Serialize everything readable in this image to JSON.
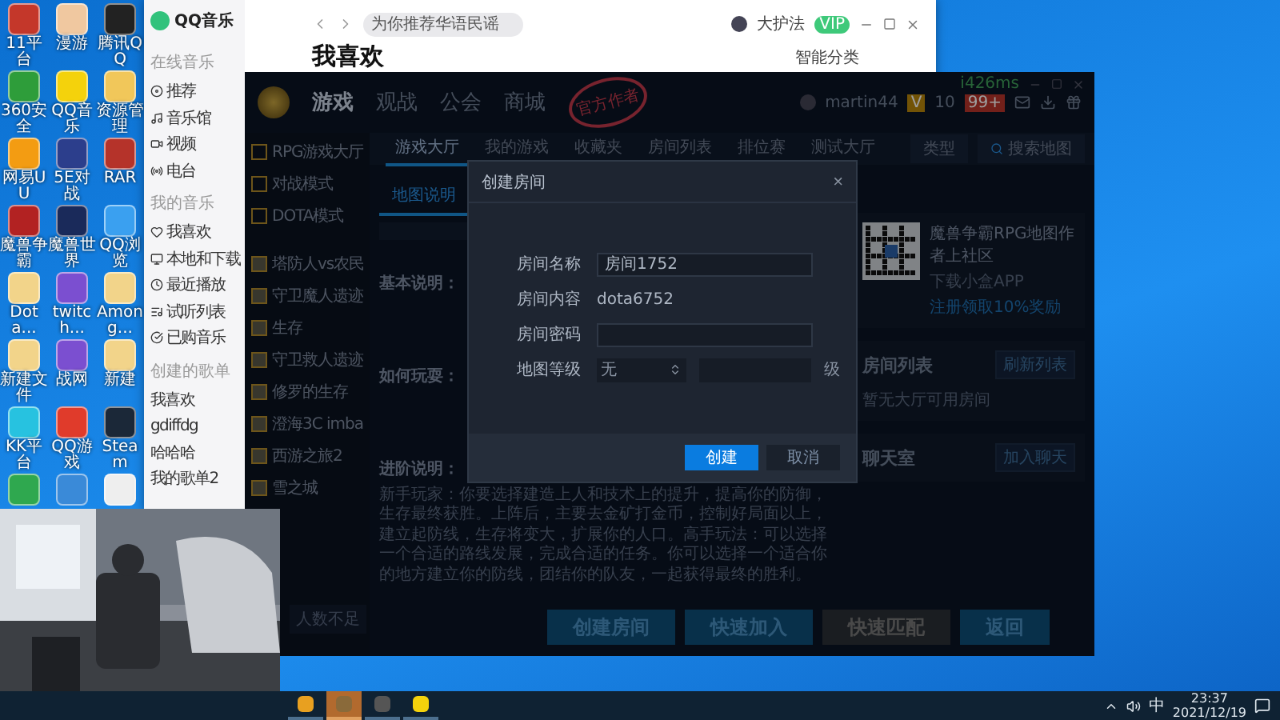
{
  "desktop": {
    "icons": [
      {
        "label": "11平台"
      },
      {
        "label": "漫游"
      },
      {
        "label": "腾讯QQ"
      },
      {
        "label": "360安全"
      },
      {
        "label": "QQ音乐"
      },
      {
        "label": "资源管理"
      },
      {
        "label": "网易UU"
      },
      {
        "label": "5E对战"
      },
      {
        "label": "RAR"
      },
      {
        "label": "魔兽争霸"
      },
      {
        "label": "魔兽世界"
      },
      {
        "label": "QQ浏览"
      },
      {
        "label": "Dota..."
      },
      {
        "label": "twitch..."
      },
      {
        "label": "Among..."
      },
      {
        "label": "新建文件"
      },
      {
        "label": "战网"
      },
      {
        "label": "新建"
      },
      {
        "label": "KK平台"
      },
      {
        "label": "QQ游戏"
      },
      {
        "label": "Steam"
      }
    ]
  },
  "music_window": {
    "logo": "QQ音乐",
    "search": {
      "placeholder": "为你推荐华语民谣"
    },
    "user": "大护法",
    "vip": "VIP",
    "title": "我喜欢",
    "sort_button": "智能分类",
    "sidebar": [
      {
        "heading": "在线音乐",
        "items": [
          {
            "label": "推荐"
          },
          {
            "label": "音乐馆"
          },
          {
            "label": "视频"
          },
          {
            "label": "电台"
          }
        ]
      },
      {
        "heading": "我的音乐",
        "items": [
          {
            "label": "我喜欢"
          },
          {
            "label": "本地和下载"
          },
          {
            "label": "最近播放"
          },
          {
            "label": "试听列表"
          },
          {
            "label": "已购音乐"
          }
        ]
      },
      {
        "heading": "创建的歌单",
        "items": [
          {
            "label": "我喜欢"
          },
          {
            "label": "gdiffdg"
          },
          {
            "label": "哈哈哈"
          },
          {
            "label": "我的歌单2"
          }
        ]
      }
    ]
  },
  "game_window": {
    "ping": "i426ms",
    "nav": [
      {
        "label": "游戏",
        "selected": true
      },
      {
        "label": "观战",
        "selected": false
      },
      {
        "label": "公会",
        "selected": false
      },
      {
        "label": "商城",
        "selected": false
      }
    ],
    "stamp": "官方作者",
    "user": "martin44",
    "level": "V",
    "count": "10",
    "badge": "99+",
    "sidebar": [
      {
        "label": "RPG游戏大厅",
        "kind": "category"
      },
      {
        "label": "对战模式",
        "kind": "category"
      },
      {
        "label": "DOTA模式",
        "kind": "category"
      },
      {
        "label": "塔防人vs农民",
        "kind": "map"
      },
      {
        "label": "守卫魔人遗迹",
        "kind": "map"
      },
      {
        "label": "生存",
        "kind": "map"
      },
      {
        "label": "守卫救人遗迹",
        "kind": "map"
      },
      {
        "label": "修罗的生存",
        "kind": "map"
      },
      {
        "label": "澄海3C imba",
        "kind": "map"
      },
      {
        "label": "西游之旅2",
        "kind": "map"
      },
      {
        "label": "雪之城",
        "kind": "map"
      }
    ],
    "sidebar_footer": "人数不足",
    "tabs": [
      {
        "label": "游戏大厅",
        "selected": true
      },
      {
        "label": "我的游戏",
        "selected": false
      },
      {
        "label": "收藏夹",
        "selected": false
      },
      {
        "label": "房间列表",
        "selected": false
      },
      {
        "label": "排位赛",
        "selected": false
      },
      {
        "label": "测试大厅",
        "selected": false
      }
    ],
    "filter": {
      "label": "类型",
      "search_placeholder": "搜索地图"
    },
    "content_tab": {
      "label": "地图说明",
      "selected": true
    },
    "sections": [
      {
        "heading": "基本说明："
      },
      {
        "heading": "如何玩耍："
      },
      {
        "heading": "进阶说明：",
        "text": "新手玩家：你要选择建造上人和技术上的提升，提高你的防御，生存最终获胜。上阵后，主要去金矿打金币，控制好局面以上，建立起防线，生存将变大，扩展你的人口。高手玩法：可以选择一个合适的路线发展，完成合适的任务。你可以选择一个适合你的地方建立你的防线，团结你的队友，一起获得最终的胜利。"
      }
    ],
    "qr_card": {
      "title": "魔兽争霸RPG地图作者上社区",
      "subtitle": "下载小盒APP",
      "link": "注册领取10%奖励"
    },
    "room_list": {
      "title": "房间列表",
      "button": "刷新列表",
      "empty": "暂无大厅可用房间"
    },
    "chat": {
      "title": "聊天室",
      "button": "加入聊天"
    },
    "actions": [
      {
        "label": "创建房间",
        "kind": "primary"
      },
      {
        "label": "快速加入",
        "kind": "primary"
      },
      {
        "label": "快速匹配",
        "kind": "disabled"
      },
      {
        "label": "返回",
        "kind": "primary"
      }
    ]
  },
  "dialog": {
    "title": "创建房间",
    "close": "×",
    "fields": [
      {
        "label": "房间名称",
        "kind": "input",
        "value": "房间1752"
      },
      {
        "label": "房间内容",
        "kind": "text",
        "value": "dota6752"
      },
      {
        "label": "房间密码",
        "kind": "input"
      },
      {
        "label": "地图等级",
        "kind": "select",
        "value": "无",
        "suffix": "级"
      }
    ],
    "buttons": [
      {
        "label": "创建",
        "kind": "primary"
      },
      {
        "label": "取消",
        "kind": "secondary"
      }
    ]
  },
  "taskbar": {
    "apps": [
      {
        "selected": false
      },
      {
        "selected": true
      },
      {
        "selected": false
      },
      {
        "selected": false
      }
    ],
    "ime": "中",
    "time": "23:37",
    "date": "2021/12/19"
  }
}
